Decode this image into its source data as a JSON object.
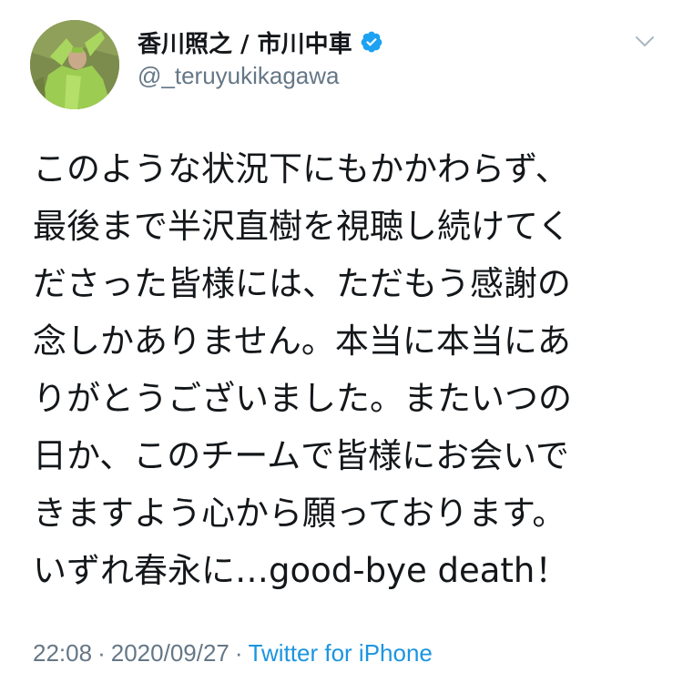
{
  "user": {
    "display_name": "香川照之 / 市川中車",
    "handle": "@_teruyukikagawa",
    "verified": true,
    "avatar_icon": "avatar-mantis-costume"
  },
  "tweet": {
    "lines": [
      "このような状況下にもかかわらず、",
      "最後まで半沢直樹を視聴し続けてく",
      "ださった皆様には、ただもう感謝の",
      "念しかありません。本当に本当にあ",
      "りがとうございました。またいつの",
      "日か、このチームで皆様にお会いで",
      "きますよう心から願っております。",
      "いずれ春永に…good-bye death！"
    ],
    "time": "22:08",
    "separator": "·",
    "date": "2020/09/27",
    "source": "Twitter for iPhone"
  },
  "icons": {
    "verified": "verified-badge-icon",
    "menu": "chevron-down-icon"
  },
  "colors": {
    "text": "#14171a",
    "secondary": "#657786",
    "link": "#1b95e0",
    "verified": "#1da1f2"
  }
}
